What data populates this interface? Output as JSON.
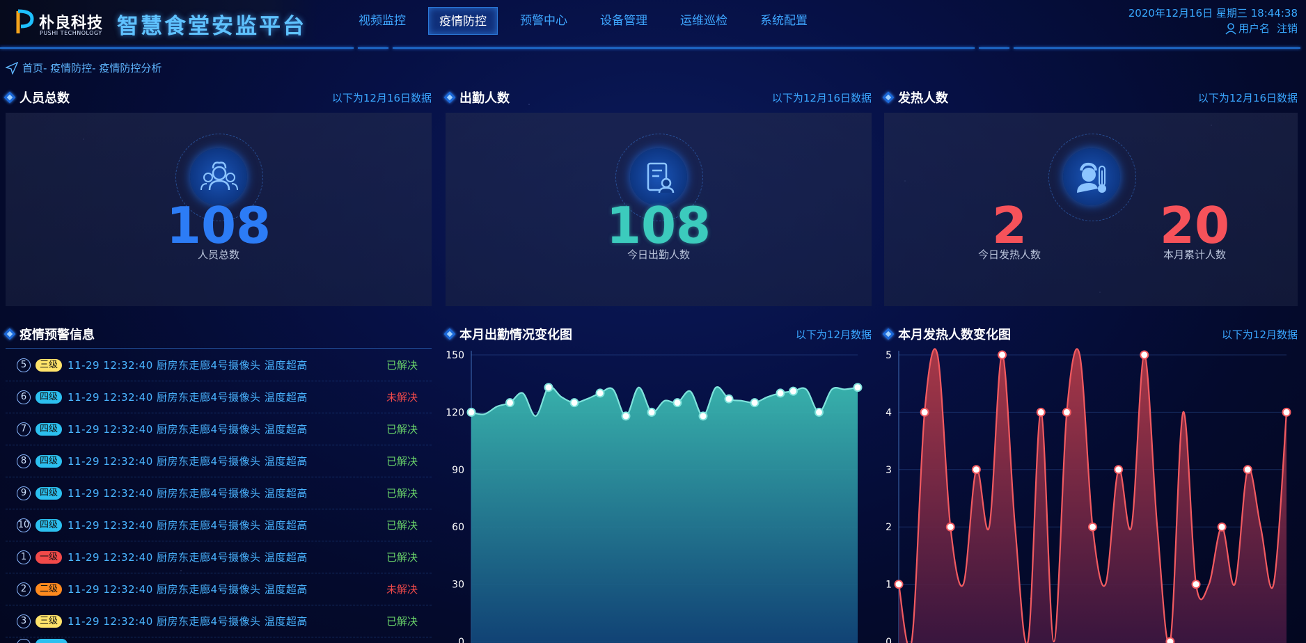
{
  "brand": {
    "cn": "朴良科技",
    "en": "PUSHI TECHNOLOGY",
    "platform": "智慧食堂安监平台"
  },
  "nav": [
    {
      "label": "视频监控",
      "active": false
    },
    {
      "label": "疫情防控",
      "active": true
    },
    {
      "label": "预警中心",
      "active": false
    },
    {
      "label": "设备管理",
      "active": false
    },
    {
      "label": "运维巡检",
      "active": false
    },
    {
      "label": "系统配置",
      "active": false
    }
  ],
  "header": {
    "datetime": "2020年12月16日 星期三 18:44:38",
    "username": "用户名",
    "logout": "注销"
  },
  "breadcrumb": "首页- 疫情防控- 疫情防控分析",
  "panels": {
    "total": {
      "title": "人员总数",
      "note": "以下为12月16日数据",
      "value": "108",
      "label": "人员总数"
    },
    "attendance": {
      "title": "出勤人数",
      "note": "以下为12月16日数据",
      "value": "108",
      "label": "今日出勤人数"
    },
    "fever": {
      "title": "发热人数",
      "note": "以下为12月16日数据",
      "today_value": "2",
      "today_label": "今日发热人数",
      "month_value": "20",
      "month_label": "本月累计人数"
    },
    "warnings": {
      "title": "疫情预警信息"
    },
    "attendance_chart": {
      "title": "本月出勤情况变化图",
      "note": "以下为12月数据"
    },
    "fever_chart": {
      "title": "本月发热人数变化图",
      "note": "以下为12月数据"
    }
  },
  "colors": {
    "total_number": "#2c7cf6",
    "attendance_number": "#3ccbbd",
    "fever_number": "#f6525a",
    "resolved": "#6ad46a",
    "unresolved": "#f24a4a",
    "level1": "#f24a4a",
    "level2": "#ff8a1e",
    "level3": "#ffe36a",
    "level4": "#2cc0f0"
  },
  "warnings": [
    {
      "idx": "5",
      "level": "三级",
      "level_key": "level3",
      "text": "11-29 12:32:40 厨房东走廊4号摄像头 温度超高",
      "status": "已解决",
      "resolved": true
    },
    {
      "idx": "6",
      "level": "四级",
      "level_key": "level4",
      "text": "11-29 12:32:40 厨房东走廊4号摄像头 温度超高",
      "status": "未解决",
      "resolved": false
    },
    {
      "idx": "7",
      "level": "四级",
      "level_key": "level4",
      "text": "11-29 12:32:40 厨房东走廊4号摄像头 温度超高",
      "status": "已解决",
      "resolved": true
    },
    {
      "idx": "8",
      "level": "四级",
      "level_key": "level4",
      "text": "11-29 12:32:40 厨房东走廊4号摄像头 温度超高",
      "status": "已解决",
      "resolved": true
    },
    {
      "idx": "9",
      "level": "四级",
      "level_key": "level4",
      "text": "11-29 12:32:40 厨房东走廊4号摄像头 温度超高",
      "status": "已解决",
      "resolved": true
    },
    {
      "idx": "10",
      "level": "四级",
      "level_key": "level4",
      "text": "11-29 12:32:40 厨房东走廊4号摄像头 温度超高",
      "status": "已解决",
      "resolved": true
    },
    {
      "idx": "1",
      "level": "一级",
      "level_key": "level1",
      "text": "11-29 12:32:40 厨房东走廊4号摄像头 温度超高",
      "status": "已解决",
      "resolved": true
    },
    {
      "idx": "2",
      "level": "二级",
      "level_key": "level2",
      "text": "11-29 12:32:40 厨房东走廊4号摄像头 温度超高",
      "status": "未解决",
      "resolved": false
    },
    {
      "idx": "3",
      "level": "三级",
      "level_key": "level3",
      "text": "11-29 12:32:40 厨房东走廊4号摄像头 温度超高",
      "status": "已解决",
      "resolved": true
    }
  ],
  "chart_data": [
    {
      "type": "area",
      "title": "本月出勤情况变化图",
      "ylim": [
        0,
        150
      ],
      "yticks": [
        0,
        30,
        60,
        90,
        120,
        150
      ],
      "grid": true,
      "color": "#3ccbbd",
      "x": [
        1,
        2,
        3,
        4,
        5,
        6,
        7,
        8,
        9,
        10,
        11,
        12,
        13,
        14,
        15,
        16,
        17,
        18,
        19,
        20,
        21,
        22,
        23,
        24,
        25,
        26,
        27,
        28,
        29,
        30,
        31
      ],
      "values": [
        120,
        119,
        123,
        125,
        130,
        118,
        133,
        128,
        125,
        127,
        130,
        132,
        118,
        133,
        120,
        126,
        125,
        131,
        118,
        133,
        127,
        126,
        125,
        128,
        130,
        131,
        132,
        120,
        132,
        132,
        133
      ],
      "marked": [
        1,
        4,
        7,
        9,
        11,
        13,
        15,
        17,
        19,
        21,
        23,
        25,
        26,
        28,
        31
      ]
    },
    {
      "type": "area",
      "title": "本月发热人数变化图",
      "ylim": [
        0,
        5
      ],
      "yticks": [
        0,
        1,
        2,
        3,
        4,
        5
      ],
      "grid": true,
      "color": "#f6525a",
      "x": [
        1,
        2,
        3,
        4,
        5,
        6,
        7,
        8,
        9,
        10,
        11,
        12,
        13,
        14,
        15,
        16,
        17,
        18,
        19,
        20,
        21,
        22,
        23,
        24,
        25,
        26,
        27,
        28,
        29,
        30,
        31
      ],
      "values": [
        1,
        0,
        4,
        5,
        2,
        1,
        3,
        2,
        5,
        2,
        0,
        4,
        0,
        4,
        5,
        2,
        1,
        3,
        2,
        5,
        2,
        0,
        4,
        1,
        1,
        2,
        1,
        3,
        2,
        1,
        4
      ],
      "marked": [
        1,
        3,
        5,
        7,
        9,
        12,
        14,
        16,
        18,
        20,
        22,
        24,
        26,
        28,
        31
      ]
    }
  ]
}
